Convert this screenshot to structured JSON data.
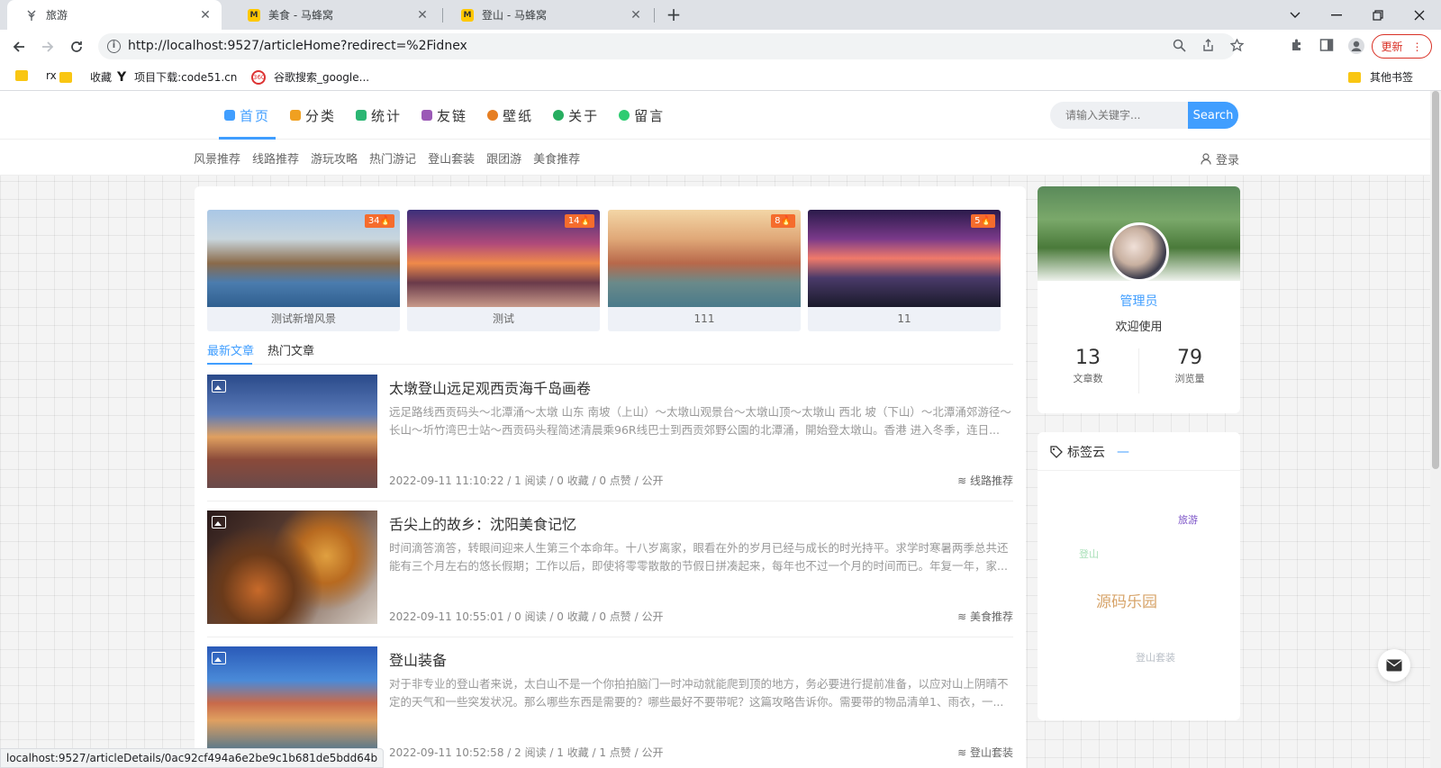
{
  "browser": {
    "tabs": [
      {
        "title": "旅游",
        "active": true
      },
      {
        "title": "美食 - 马蜂窝",
        "active": false
      },
      {
        "title": "登山 - 马蜂窝",
        "active": false
      }
    ],
    "url": "http://localhost:9527/articleHome?redirect=%2Fidnex",
    "update_label": "更新",
    "bookmarks": [
      "rx",
      "收藏",
      "项目下载:code51.cn",
      "谷歌搜索_google..."
    ],
    "other_bookmarks": "其他书签",
    "status_url": "localhost:9527/articleDetails/0ac92cf494a6e2be9c1b681de5bdd64b"
  },
  "site": {
    "nav": [
      {
        "label": "首页",
        "color": "#409eff",
        "active": true
      },
      {
        "label": "分类",
        "color": "#f0a020",
        "active": false
      },
      {
        "label": "统计",
        "color": "#2bb673",
        "active": false
      },
      {
        "label": "友链",
        "color": "#9b59b6",
        "active": false
      },
      {
        "label": "壁纸",
        "color": "#e67e22",
        "active": false
      },
      {
        "label": "关于",
        "color": "#27ae60",
        "active": false
      },
      {
        "label": "留言",
        "color": "#2ecc71",
        "active": false
      }
    ],
    "search": {
      "placeholder": "请输入关键字...",
      "button": "Search"
    },
    "subnav": [
      "风景推荐",
      "线路推荐",
      "游玩攻略",
      "热门游记",
      "登山套装",
      "跟团游",
      "美食推荐"
    ],
    "login": "登录",
    "cards": [
      {
        "title": "测试新增风景",
        "count": "34🔥"
      },
      {
        "title": "测试",
        "count": "14🔥"
      },
      {
        "title": "111",
        "count": "8🔥"
      },
      {
        "title": "11",
        "count": "5🔥"
      }
    ],
    "article_tabs": [
      "最新文章",
      "热门文章"
    ],
    "articles": [
      {
        "title": "太墩登山远足观西贡海千岛画卷",
        "summary": "远足路线西贡码头～北潭涌～太墩 山东 南坡（上山）～太墩山观景台～太墩山顶～太墩山 西北 坡（下山）～北潭涌郊游径～长山～圻竹湾巴士站～西贡码头程简述清晨乘96R线巴士到西贡郊野公園的北潭涌，開始登太墩山。香港 进入冬季，连日...",
        "meta": "2022-09-11 11:10:22 / 1 阅读 / 0 收藏 / 0 点赞 / 公开",
        "category": "线路推荐"
      },
      {
        "title": "舌尖上的故乡：沈阳美食记忆",
        "summary": "时间滴答滴答，转眼间迎来人生第三个本命年。十八岁离家，眼看在外的岁月已经与成长的时光持平。求学时寒暑两季总共还能有三个月左右的悠长假期；工作以后，即使将零零散散的节假日拼凑起来，每年也不过一个月的时间而已。年复一年，家...",
        "meta": "2022-09-11 10:55:01 / 0 阅读 / 0 收藏 / 0 点赞 / 公开",
        "category": "美食推荐"
      },
      {
        "title": "登山装备",
        "summary": "对于非专业的登山者来说，太白山不是一个你拍拍脑门一时冲动就能爬到顶的地方，务必要进行提前准备，以应对山上阴晴不定的天气和一些突发状况。那么哪些东西是需要的？哪些最好不要带呢？这篇攻略告诉你。需要带的物品清单1、雨衣，一...",
        "meta": "2022-09-11 10:52:58 / 2 阅读 / 1 收藏 / 1 点赞 / 公开",
        "category": "登山套装"
      }
    ],
    "profile": {
      "name": "管理员",
      "welcome": "欢迎使用",
      "stats": [
        {
          "num": "13",
          "label": "文章数"
        },
        {
          "num": "79",
          "label": "浏览量"
        }
      ]
    },
    "tagcloud": {
      "title": "标签云",
      "dash": "—",
      "tags": [
        {
          "text": "旅游",
          "color": "#7b52c7"
        },
        {
          "text": "登山",
          "color": "#a8e0b8"
        },
        {
          "text": "源码乐园",
          "color": "#d7a46a"
        },
        {
          "text": "登山套装",
          "color": "#b8bec6"
        }
      ]
    }
  }
}
